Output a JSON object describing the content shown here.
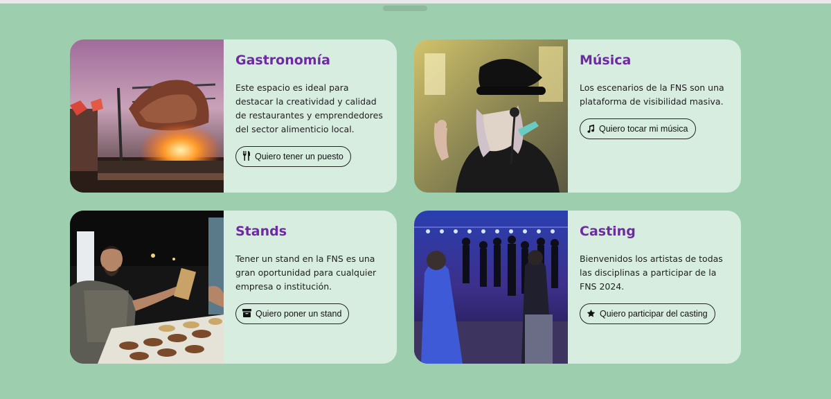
{
  "cards": [
    {
      "title": "Gastronomía",
      "description": "Este espacio es ideal para destacar la creatividad y calidad de restaurantes y emprendedores del sector alimenticio local.",
      "button_label": "Quiero tener un puesto",
      "button_icon": "fork-knife-icon",
      "photo": "grilled-meat-photo"
    },
    {
      "title": "Música",
      "description": "Los escenarios de la FNS son una plataforma de visibilidad masiva.",
      "button_label": "Quiero tocar mi música",
      "button_icon": "music-note-icon",
      "photo": "singer-photo"
    },
    {
      "title": "Stands",
      "description": "Tener un stand en la FNS es una gran oportunidad para cualquier empresa o institución.",
      "button_label": "Quiero poner un stand",
      "button_icon": "archive-box-icon",
      "photo": "vendor-stand-photo"
    },
    {
      "title": "Casting",
      "description": "Bienvenidos los artistas de todas las disciplinas a participar de la FNS 2024.",
      "button_label": "Quiero participar del casting",
      "button_icon": "star-icon",
      "photo": "dancers-stage-photo"
    }
  ],
  "colors": {
    "background": "#9dcfae",
    "card": "#d7ede0",
    "title": "#6f2aa3"
  }
}
